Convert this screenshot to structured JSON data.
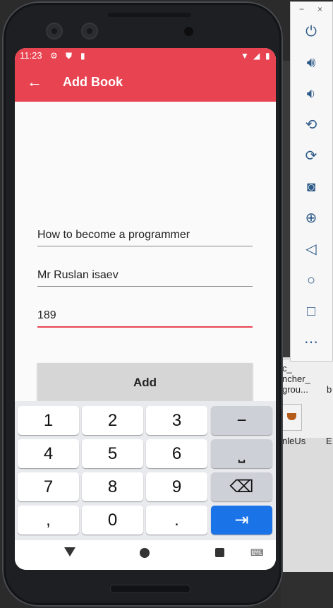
{
  "status": {
    "time": "11:23"
  },
  "appbar": {
    "title": "Add Book"
  },
  "form": {
    "title_value": "How to become a programmer",
    "author_value": "Mr Ruslan isaev",
    "pages_value": "189",
    "add_label": "Add"
  },
  "keyboard": {
    "rows": [
      [
        "1",
        "2",
        "3",
        "−"
      ],
      [
        "4",
        "5",
        "6",
        "⎵"
      ],
      [
        "7",
        "8",
        "9",
        "⌫"
      ],
      [
        ",",
        "0",
        ".",
        "⇥"
      ]
    ]
  },
  "emulator": {
    "minimize": "−",
    "close": "×",
    "buttons": [
      "power-icon",
      "volume-up-icon",
      "volume-down-icon",
      "rotate-left-icon",
      "rotate-right-icon",
      "camera-icon",
      "zoom-icon",
      "back-icon",
      "home-icon",
      "overview-icon",
      "more-icon"
    ]
  },
  "desktop": {
    "label1a": "c_",
    "label1b": "ncher_",
    "label1c": "grou...",
    "label2": "b",
    "label3": "nleUs",
    "label4": "E"
  },
  "colors": {
    "accent": "#e84350",
    "action": "#1b73e8"
  }
}
